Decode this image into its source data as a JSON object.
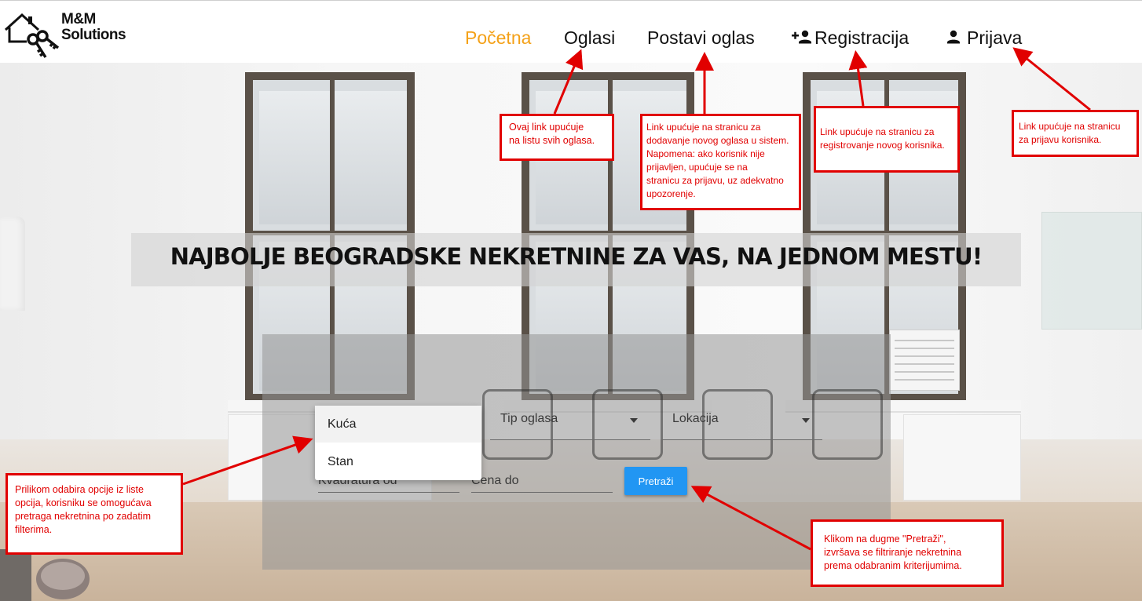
{
  "header": {
    "logo_line1": "M&M",
    "logo_line2": "Solutions",
    "nav": [
      {
        "label": "Početna",
        "active": true
      },
      {
        "label": "Oglasi",
        "active": false
      },
      {
        "label": "Postavi oglas",
        "active": false
      },
      {
        "label": "Registracija",
        "active": false,
        "icon": "add-person-icon"
      },
      {
        "label": "Prijava",
        "active": false,
        "icon": "person-icon"
      }
    ],
    "colors": {
      "active": "#f4a118",
      "text": "#111111"
    }
  },
  "hero": {
    "title": "NAJBOLJE BEOGRADSKE NEKRETNINE ZA VAS, NA JEDNOM MESTU!"
  },
  "search": {
    "property_type_options": [
      "Kuća",
      "Stan"
    ],
    "ad_type_label": "Tip oglasa",
    "location_label": "Lokacija",
    "area_from_placeholder": "Kvadratura od",
    "price_to_placeholder": "Cena do",
    "search_button": "Pretraži",
    "button_color": "#2196f3"
  },
  "annotations": {
    "color": "#e10000",
    "oglasi": "Ovaj link upućuje\nna listu svih oglasa.",
    "postavi": "Link upućuje na stranicu za\ndodavanje novog oglasa u sistem.\nNapomena: ako korisnik nije\nprijavljen, upućuje se na\nstranicu za prijavu, uz adekvatno\nupozorenje.",
    "registracija": "Link upućuje na stranicu za\nregistrovanje novog korisnika.",
    "prijava": "Link upućuje na stranicu\nza prijavu korisnika.",
    "dropdown": "Prilikom odabira opcije iz liste\nopcija, korisniku se omogućava\npretraga nekretnina po zadatim\nfilterima.",
    "button": "Klikom na dugme \"Pretraži\",\nizvršava se filtriranje nekretnina\nprema odabranim kriterijumima."
  }
}
